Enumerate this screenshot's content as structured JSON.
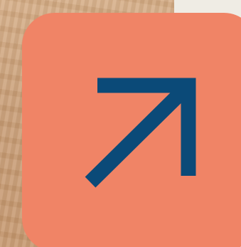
{
  "colors": {
    "background": "#efece4",
    "wood": "#c99e76",
    "tile": "#f08466",
    "arrow": "#0b4a78"
  },
  "icons": {
    "tile_icon": "arrow-up-right-icon"
  }
}
